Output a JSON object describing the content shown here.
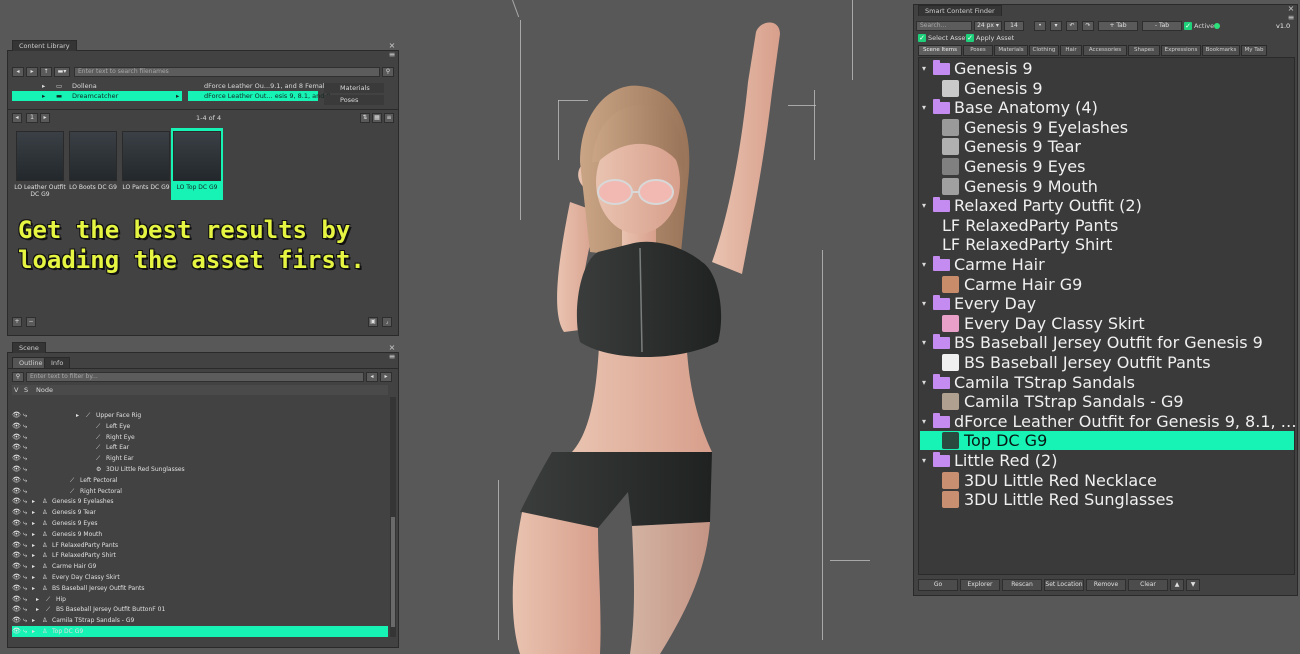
{
  "content_library": {
    "title": "Content Library",
    "search_placeholder": "Enter text to search filenames",
    "rows": [
      {
        "left": "Dollena",
        "right": "dForce Leather Ou...9.1, and 8 Female"
      },
      {
        "left": "Dreamcatcher",
        "right": "dForce Leather Out... esis 9, 8.1, and 8"
      }
    ],
    "submenu": [
      "Materials",
      "Poses"
    ],
    "page": "1",
    "count": "1-4 of 4",
    "thumbnails": [
      {
        "label": "LO Leather Outfit DC G9"
      },
      {
        "label": "LO Boots DC G9"
      },
      {
        "label": "LO Pants DC G9"
      },
      {
        "label": "LO Top DC G9"
      }
    ],
    "tip": "Get the best results by\nloading the asset first."
  },
  "scene": {
    "title": "Scene",
    "tabs": [
      "Outline",
      "Info"
    ],
    "filter_placeholder": "Enter text to filter by...",
    "col_v": "V",
    "col_s": "S",
    "col_node": "Node",
    "nodes": [
      {
        "label": "Upper Face Rig"
      },
      {
        "label": "Left Eye"
      },
      {
        "label": "Right Eye"
      },
      {
        "label": "Left Ear"
      },
      {
        "label": "Right Ear"
      },
      {
        "label": "3DU Little Red Sunglasses"
      },
      {
        "label": "Left Pectoral"
      },
      {
        "label": "Right Pectoral"
      },
      {
        "label": "Genesis 9 Eyelashes"
      },
      {
        "label": "Genesis 9 Tear"
      },
      {
        "label": "Genesis 9 Eyes"
      },
      {
        "label": "Genesis 9 Mouth"
      },
      {
        "label": "LF RelaxedParty Pants"
      },
      {
        "label": "LF RelaxedParty Shirt"
      },
      {
        "label": "Carme Hair G9"
      },
      {
        "label": "Every Day Classy Skirt"
      },
      {
        "label": "BS Baseball Jersey Outfit Pants"
      },
      {
        "label": "Hip"
      },
      {
        "label": "BS Baseball Jersey Outfit ButtonF 01"
      },
      {
        "label": "Camila TStrap Sandals - G9"
      },
      {
        "label": "Top DC G9"
      }
    ]
  },
  "finder": {
    "title": "Smart Content Finder",
    "search_placeholder": "Search...",
    "size": "24 px",
    "size_num": "14",
    "add_tab": "+ Tab",
    "remove_tab": "- Tab",
    "active": "Active",
    "version": "v1.0",
    "select_asset": "Select Asset",
    "apply_asset": "Apply Asset",
    "tabs": [
      "Scene Items",
      "Poses",
      "Materials",
      "Clothing",
      "Hair",
      "Accessories",
      "Shapes",
      "Expressions",
      "Bookmarks",
      "My Tab"
    ],
    "tree": [
      {
        "label": "Genesis 9",
        "type": "folder"
      },
      {
        "label": "Genesis 9",
        "type": "item",
        "icon": "figure"
      },
      {
        "label": "Base Anatomy (4)",
        "type": "folder"
      },
      {
        "label": "Genesis 9 Eyelashes",
        "type": "item",
        "icon": "lash"
      },
      {
        "label": "Genesis 9 Tear",
        "type": "item",
        "icon": "tear"
      },
      {
        "label": "Genesis 9 Eyes",
        "type": "item",
        "icon": "eye"
      },
      {
        "label": "Genesis 9 Mouth",
        "type": "item",
        "icon": "mouth"
      },
      {
        "label": "Relaxed Party Outfit (2)",
        "type": "folder"
      },
      {
        "label": "LF RelaxedParty Pants",
        "type": "plain"
      },
      {
        "label": "LF RelaxedParty Shirt",
        "type": "plain"
      },
      {
        "label": "Carme Hair",
        "type": "folder"
      },
      {
        "label": "Carme Hair G9",
        "type": "item",
        "icon": "hair"
      },
      {
        "label": "Every Day",
        "type": "folder"
      },
      {
        "label": "Every Day Classy Skirt",
        "type": "item",
        "icon": "skirt"
      },
      {
        "label": "BS Baseball Jersey Outfit for Genesis 9",
        "type": "folder"
      },
      {
        "label": "BS Baseball Jersey Outfit Pants",
        "type": "item",
        "icon": "pants"
      },
      {
        "label": "Camila TStrap Sandals",
        "type": "folder"
      },
      {
        "label": "Camila TStrap Sandals - G9",
        "type": "item",
        "icon": "sandal"
      },
      {
        "label": "dForce Leather Outfit for Genesis 9, 8.1, …",
        "type": "folder"
      },
      {
        "label": "Top DC G9",
        "type": "item",
        "icon": "top",
        "selected": true
      },
      {
        "label": "Little Red (2)",
        "type": "folder"
      },
      {
        "label": "3DU Little Red Necklace",
        "type": "item",
        "icon": "face"
      },
      {
        "label": "3DU Little Red Sunglasses",
        "type": "item",
        "icon": "face"
      }
    ],
    "buttons": [
      "Go",
      "Explorer",
      "Rescan",
      "Set Location",
      "Remove",
      "Clear",
      "▲",
      "▼"
    ]
  },
  "colors": {
    "highlight": "#17f2b5",
    "folder": "#c48cf0",
    "tip_text": "#e6f542"
  }
}
